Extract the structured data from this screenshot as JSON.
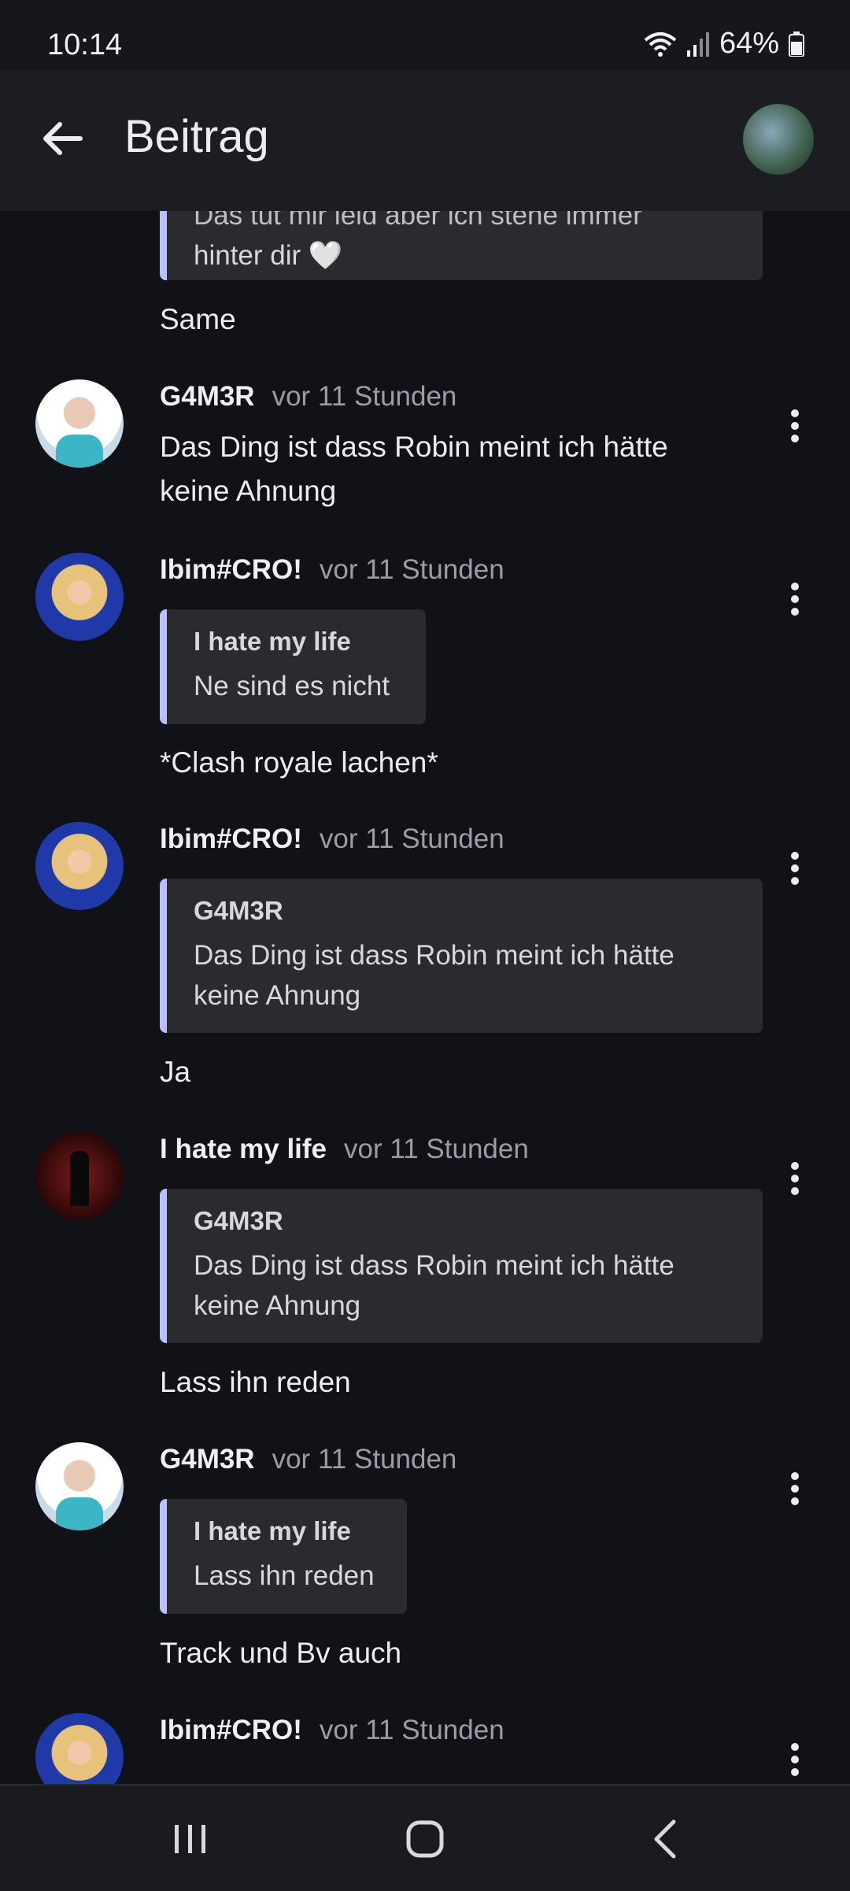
{
  "status_bar": {
    "time": "10:14",
    "battery": "64%"
  },
  "header": {
    "title": "Beitrag"
  },
  "messages": [
    {
      "quote": {
        "text_partial": "Das tut mir leid aber ich stehe immer",
        "text": "hinter dir 🤍"
      },
      "text": "Same"
    },
    {
      "author": "G4M3R",
      "time": "vor 11 Stunden",
      "text_line1": "Das Ding ist dass Robin meint ich hätte",
      "text_line2": "keine Ahnung"
    },
    {
      "author": "Ibim#CRO!",
      "time": "vor 11 Stunden",
      "quote": {
        "author": "I hate my life",
        "text": "Ne sind es nicht"
      },
      "text": "*Clash royale lachen*"
    },
    {
      "author": "Ibim#CRO!",
      "time": "vor 11 Stunden",
      "quote": {
        "author": "G4M3R",
        "text_line1": "Das Ding ist dass Robin meint ich hätte",
        "text_line2": "keine Ahnung"
      },
      "text": "Ja"
    },
    {
      "author": "I hate my life",
      "time": "vor 11 Stunden",
      "quote": {
        "author": "G4M3R",
        "text_line1": "Das Ding ist dass Robin meint ich hätte",
        "text_line2": "keine Ahnung"
      },
      "text": "Lass ihn reden"
    },
    {
      "author": "G4M3R",
      "time": "vor 11 Stunden",
      "quote": {
        "author": "I hate my life",
        "text": "Lass ihn reden"
      },
      "text": "Track und Bv auch"
    },
    {
      "author": "Ibim#CRO!",
      "time": "vor 11 Stunden"
    }
  ],
  "colors": {
    "background": "#111218",
    "quote_bg": "#2a2b31",
    "quote_accent": "#b7c1ff"
  }
}
